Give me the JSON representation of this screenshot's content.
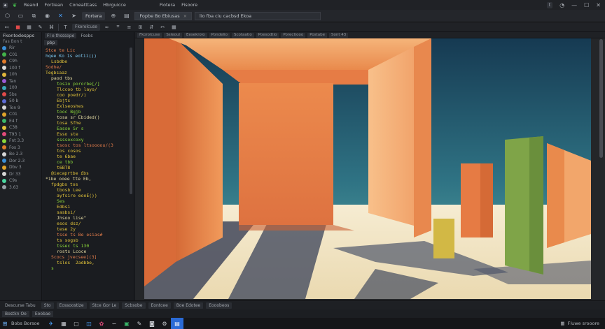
{
  "titlebar": {
    "menu": [
      "Reand",
      "Fortiean",
      "Coneatttass",
      "Hbrguicce"
    ],
    "menu_right": [
      "Fiotera",
      "Fisoore"
    ],
    "icon_right": "t"
  },
  "toolbar": {
    "tool_tab": "Fortera",
    "doc_tab_1": "Fopbe Bo Ebiusas",
    "doc_tab_2": "lio fba ciu cacbsd Ekoa"
  },
  "toolbar2": {
    "chip_a": "Fkorolcuse",
    "chips": [
      "Ssleoul",
      "Eesekrolo",
      "Pondelio",
      "Scotaatio",
      "Poesodtio",
      "Porectiooo",
      "Postabe",
      "Sont 43"
    ]
  },
  "left_panel": {
    "title": "Fkontodespps",
    "subtitle": "Fas Bon t",
    "items": [
      {
        "label": "Rir",
        "color": "#3a8fd8"
      },
      {
        "label": "C01",
        "color": "#42b34a"
      },
      {
        "label": "C9h",
        "color": "#e07b2a"
      },
      {
        "label": "100 f",
        "color": "#d9d9d9"
      },
      {
        "label": "10h",
        "color": "#e0b63a"
      },
      {
        "label": "Tan",
        "color": "#9b59d6"
      },
      {
        "label": "100",
        "color": "#3aa8b8"
      },
      {
        "label": "5bs",
        "color": "#e04a4a"
      },
      {
        "label": "50 b",
        "color": "#5c6bd6"
      },
      {
        "label": "Ton 9",
        "color": "#d6d6d6"
      },
      {
        "label": "C01",
        "color": "#e0a32a"
      },
      {
        "label": "E4 f",
        "color": "#3ab86a"
      },
      {
        "label": "C38",
        "color": "#e0c23a"
      },
      {
        "label": "T93 1",
        "color": "#e04a7a"
      },
      {
        "label": "Fnt 3.3",
        "color": "#8ad63a"
      },
      {
        "label": "Fos 3",
        "color": "#e07b2a"
      },
      {
        "label": "Bo 2.3",
        "color": "#d6d6d6"
      },
      {
        "label": "Dor 2.3",
        "color": "#3a8fd8"
      },
      {
        "label": "Dbv 3",
        "color": "#e0a32a"
      },
      {
        "label": "Dr 33",
        "color": "#d6d6d6"
      },
      {
        "label": "C9s",
        "color": "#4ad6a0"
      },
      {
        "label": "3.63",
        "color": "#9aa0a8"
      }
    ]
  },
  "code_panel": {
    "tab_a": "Fl e  thsssope",
    "tab_b": "Fsebs",
    "tab_c": "pbp",
    "lines": [
      {
        "text": "Stce te Lic",
        "color": "#e07b4a",
        "indent": 0
      },
      {
        "text": "hqee Ko 1s eotii())",
        "color": "#7ec8f0",
        "indent": 0
      },
      {
        "text": "Lsbdbe",
        "color": "#e0c23a",
        "indent": 1
      },
      {
        "text": "Sodhe/",
        "color": "#e07b4a",
        "indent": 0
      },
      {
        "text": "Tegbsaaz",
        "color": "#e0c23a",
        "indent": 0
      },
      {
        "text": "paod tbs",
        "color": "#e0d6a0",
        "indent": 1
      },
      {
        "text": "tosio pororbe[/]",
        "color": "#8ad63a",
        "indent": 2
      },
      {
        "text": "Tlccoo tb layo/",
        "color": "#e0c23a",
        "indent": 2
      },
      {
        "text": "coo poedr/)",
        "color": "#e0c23a",
        "indent": 2
      },
      {
        "text": "Ebjts",
        "color": "#e0c23a",
        "indent": 2
      },
      {
        "text": "Exlseoshes",
        "color": "#e0c23a",
        "indent": 2
      },
      {
        "text": "tooc Bgjb",
        "color": "#8ad63a",
        "indent": 2
      },
      {
        "text": "tosa sr Ebided()",
        "color": "#e0d6a0",
        "indent": 2
      },
      {
        "text": "tosa Sfhe",
        "color": "#e0c23a",
        "indent": 2
      },
      {
        "text": "Easse Sr s",
        "color": "#8ad63a",
        "indent": 2
      },
      {
        "text": "Esso ste",
        "color": "#e0c23a",
        "indent": 2
      },
      {
        "text": "ssssoxcoxy",
        "color": "#8ad63a",
        "indent": 2
      },
      {
        "text": "tsosc tos ltsoooou/(3",
        "color": "#e07b4a",
        "indent": 2
      },
      {
        "text": "tos cosos",
        "color": "#e0c23a",
        "indent": 2
      },
      {
        "text": "te 6bae",
        "color": "#e0c23a",
        "indent": 2
      },
      {
        "text": "ce tbb",
        "color": "#8ad63a",
        "indent": 2
      },
      {
        "text": "t6BT8",
        "color": "#e0c23a",
        "indent": 2
      },
      {
        "text": "@iecaprtbe £bs",
        "color": "#e0c23a",
        "indent": 1
      },
      {
        "text": "*ibe ooee tte Eb,",
        "color": "#e0d6a0",
        "indent": 0
      },
      {
        "text": "fpdgbs tos",
        "color": "#e0c23a",
        "indent": 1
      },
      {
        "text": "tbosb Lee",
        "color": "#e0c23a",
        "indent": 2
      },
      {
        "text": "ayfsire eooE())",
        "color": "#e0c23a",
        "indent": 2
      },
      {
        "text": "Ses",
        "color": "#8ad63a",
        "indent": 2
      },
      {
        "text": "Edbsi",
        "color": "#e0c23a",
        "indent": 2
      },
      {
        "text": "sasbsi/",
        "color": "#e0c23a",
        "indent": 2
      },
      {
        "text": "Jhsoo lise\"",
        "color": "#e0d6a0",
        "indent": 2
      },
      {
        "text": "esos dsz/",
        "color": "#e0c23a",
        "indent": 2
      },
      {
        "text": "tese 2y",
        "color": "#e0c23a",
        "indent": 2
      },
      {
        "text": "tsse ts Be esias#",
        "color": "#e07b4a",
        "indent": 2
      },
      {
        "text": "ts sogsb",
        "color": "#e0c23a",
        "indent": 2
      },
      {
        "text": "tssec ts 130",
        "color": "#8ad63a",
        "indent": 2
      },
      {
        "text": "rosts Lcoce",
        "color": "#e0d6a0",
        "indent": 2
      },
      {
        "text": "Scocs jvecsee](3]",
        "color": "#e07b4a",
        "indent": 1
      },
      {
        "text": "tslos  2adbbe,",
        "color": "#e0c23a",
        "indent": 2
      },
      {
        "text": "s",
        "color": "#8ad63a",
        "indent": 1
      }
    ]
  },
  "statusbar": {
    "items": [
      "Descurse  Tabu",
      "Sto",
      "Eossoostize",
      "Stce Gor Le",
      "Scbsobe",
      "Eontcee",
      "Boe Edotee",
      "Eooobeos"
    ]
  },
  "statusbar2": {
    "left": "Bostkn Oe",
    "right": "Eoobae"
  },
  "taskbar": {
    "search_label": "Bobs Borsoe",
    "tray_label": "Fluwe srooore"
  },
  "colors": {
    "sky_top": "#163a52",
    "sky_bottom": "#4a9aa0",
    "floor": "#f0e3c2",
    "orange": "#e8844a",
    "orange_dark": "#c9582e",
    "peach": "#f4b37a",
    "green": "#7fa448",
    "mustard": "#d2b845",
    "shadow": "#4b5060"
  }
}
